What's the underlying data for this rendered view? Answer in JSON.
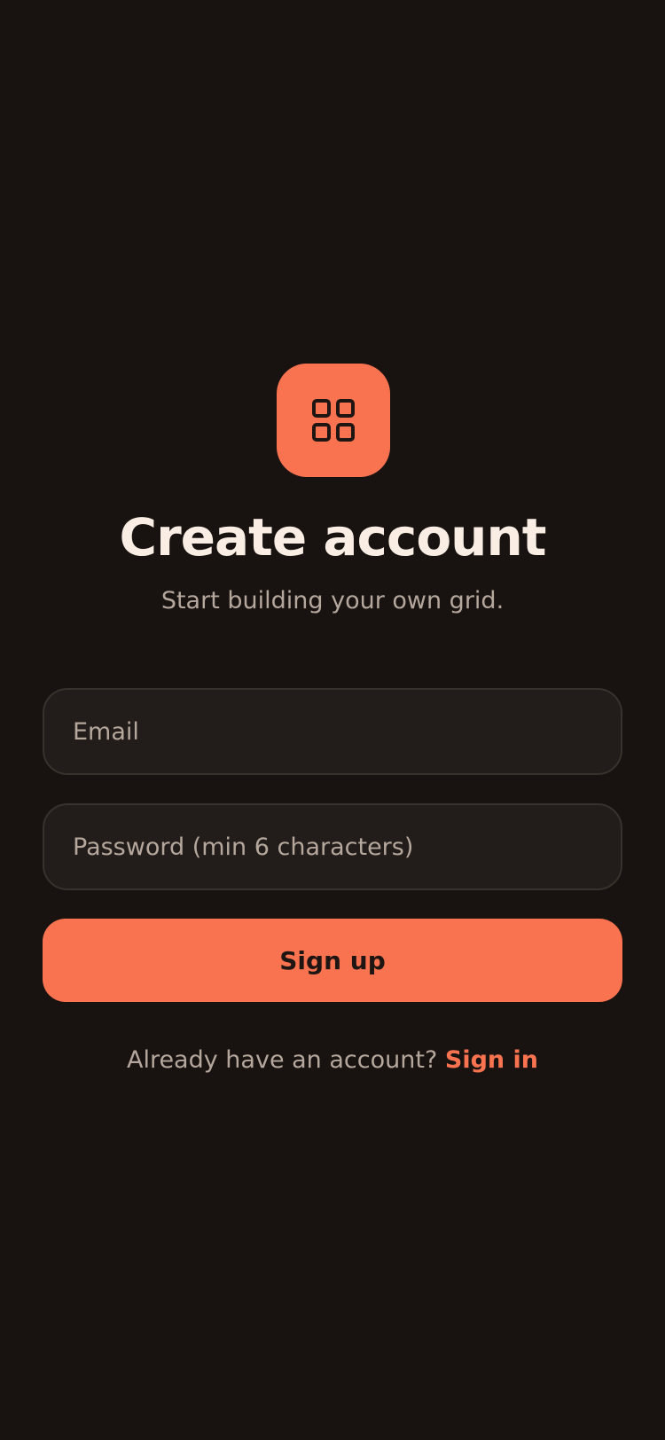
{
  "colors": {
    "background": "#181311",
    "accent": "#fa7350",
    "title_text": "#faeee4",
    "muted_text": "#b5a79c",
    "field_background": "#221d1a",
    "field_border": "#39312c",
    "button_text": "#1f1512"
  },
  "logo": {
    "icon": "grid-icon"
  },
  "header": {
    "title": "Create account",
    "subtitle": "Start building your own grid."
  },
  "form": {
    "email": {
      "value": "",
      "placeholder": "Email"
    },
    "password": {
      "value": "",
      "placeholder": "Password (min 6 characters)"
    },
    "submit_label": "Sign up"
  },
  "footer": {
    "prompt": "Already have an account?",
    "link_label": "Sign in"
  }
}
